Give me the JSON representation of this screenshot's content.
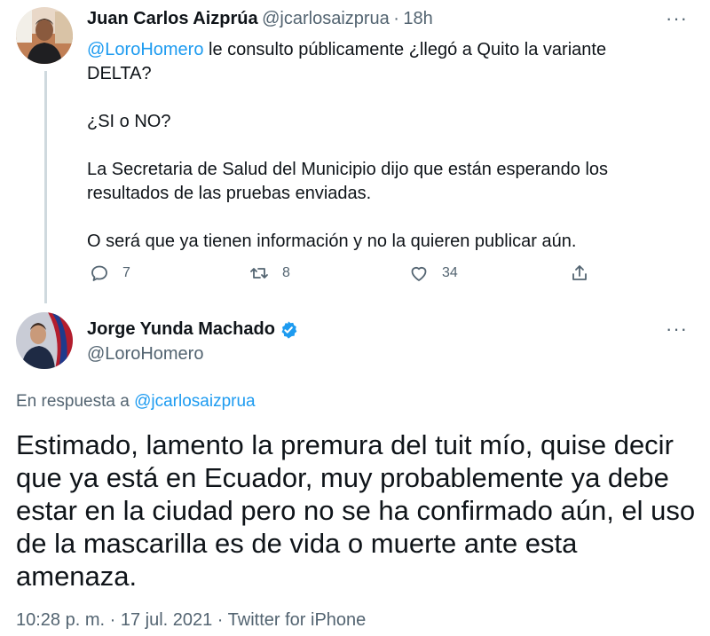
{
  "tweet1": {
    "author_name": "Juan Carlos Aizprúa",
    "handle": "@jcarlosaizprua",
    "separator": "·",
    "time": "18h",
    "mention": "@LoroHomero",
    "line1_rest": " le consulto públicamente ¿llegó a Quito la variante",
    "line2": "DELTA?",
    "para2": "¿SI o NO?",
    "para3_line1": "La Secretaria de Salud del Municipio dijo que están esperando los",
    "para3_line2": "resultados de las pruebas enviadas.",
    "para4": "O será que ya tienen información y no la quieren publicar aún.",
    "replies": "7",
    "retweets": "8",
    "likes": "34",
    "more_label": "···"
  },
  "tweet2": {
    "author_name": "Jorge Yunda Machado",
    "handle": "@LoroHomero",
    "verified_icon": "verified-badge-icon",
    "more_label": "···",
    "reply_prefix": "En respuesta a",
    "reply_to": "@jcarlosaizprua",
    "body_lines": [
      "Estimado, lamento la premura del tuit mío, quise decir",
      "que ya está en Ecuador, muy probablemente ya debe",
      "estar en la ciudad pero no se ha confirmado aún, el uso",
      "de la mascarilla es de vida o muerte ante esta",
      "amenaza."
    ],
    "timestamp": "10:28 p. m. · 17 jul. 2021 · Twitter for iPhone"
  },
  "colors": {
    "accent": "#1d9bf0",
    "secondary_text": "#536471",
    "primary_text": "#0f1419",
    "thread_line": "#cfd9de"
  }
}
